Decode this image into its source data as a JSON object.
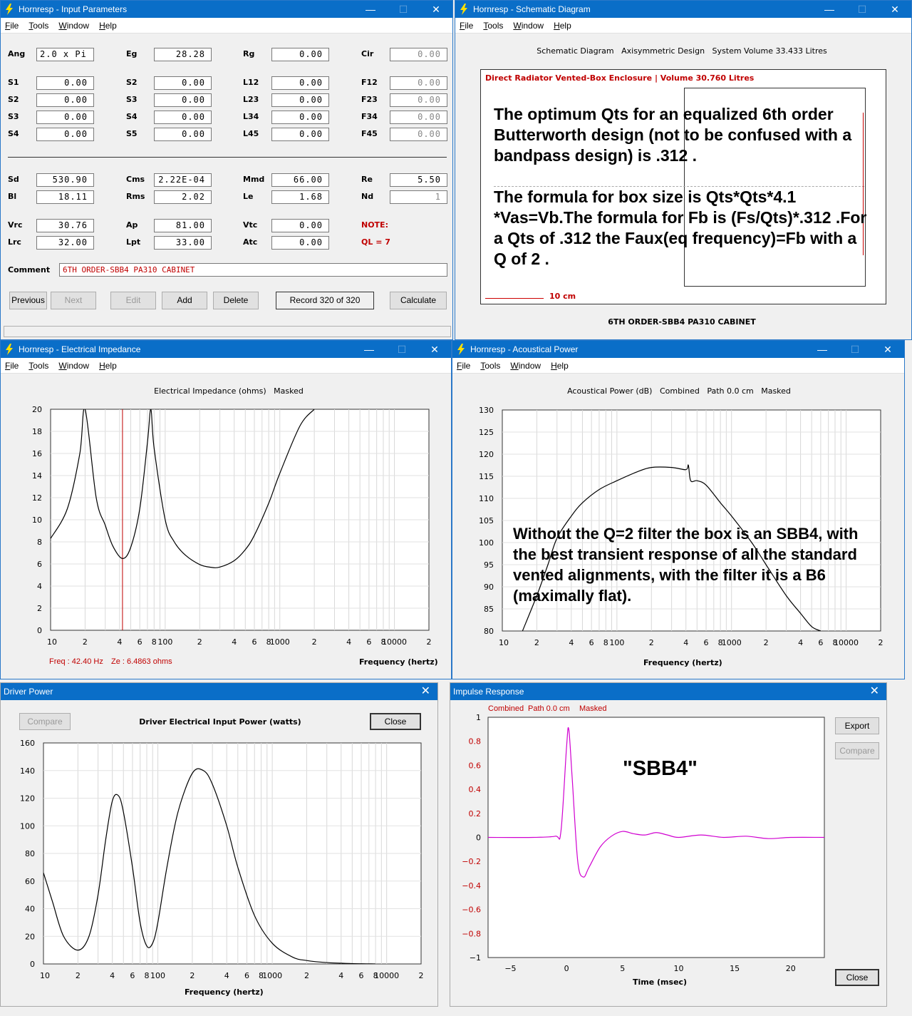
{
  "input_params": {
    "title": "Hornresp - Input Parameters",
    "menu": [
      "File",
      "Tools",
      "Window",
      "Help"
    ],
    "row1": [
      {
        "label": "Ang",
        "value": "2.0 x Pi"
      },
      {
        "label": "Eg",
        "value": "28.28"
      },
      {
        "label": "Rg",
        "value": "0.00"
      },
      {
        "label": "Cir",
        "value": "0.00"
      }
    ],
    "segments": [
      [
        {
          "label": "S1",
          "value": "0.00"
        },
        {
          "label": "S2",
          "value": "0.00"
        },
        {
          "label": "L12",
          "value": "0.00"
        },
        {
          "label": "F12",
          "value": "0.00"
        }
      ],
      [
        {
          "label": "S2",
          "value": "0.00"
        },
        {
          "label": "S3",
          "value": "0.00"
        },
        {
          "label": "L23",
          "value": "0.00"
        },
        {
          "label": "F23",
          "value": "0.00"
        }
      ],
      [
        {
          "label": "S3",
          "value": "0.00"
        },
        {
          "label": "S4",
          "value": "0.00"
        },
        {
          "label": "L34",
          "value": "0.00"
        },
        {
          "label": "F34",
          "value": "0.00"
        }
      ],
      [
        {
          "label": "S4",
          "value": "0.00"
        },
        {
          "label": "S5",
          "value": "0.00"
        },
        {
          "label": "L45",
          "value": "0.00"
        },
        {
          "label": "F45",
          "value": "0.00"
        }
      ]
    ],
    "driver": [
      [
        {
          "label": "Sd",
          "value": "530.90"
        },
        {
          "label": "Cms",
          "value": "2.22E-04"
        },
        {
          "label": "Mmd",
          "value": "66.00"
        },
        {
          "label": "Re",
          "value": "5.50"
        }
      ],
      [
        {
          "label": "Bl",
          "value": "18.11"
        },
        {
          "label": "Rms",
          "value": "2.02"
        },
        {
          "label": "Le",
          "value": "1.68"
        },
        {
          "label": "Nd",
          "value": "1"
        }
      ]
    ],
    "chamber": [
      [
        {
          "label": "Vrc",
          "value": "30.76"
        },
        {
          "label": "Ap",
          "value": "81.00"
        },
        {
          "label": "Vtc",
          "value": "0.00"
        },
        {
          "label": "NOTE:",
          "value": ""
        }
      ],
      [
        {
          "label": "Lrc",
          "value": "32.00"
        },
        {
          "label": "Lpt",
          "value": "33.00"
        },
        {
          "label": "Atc",
          "value": "0.00"
        },
        {
          "label": "QL = 7",
          "value": ""
        }
      ]
    ],
    "comment_label": "Comment",
    "comment": "6TH ORDER-SBB4 PA310 CABINET",
    "buttons": {
      "previous": "Previous",
      "next": "Next",
      "edit": "Edit",
      "add": "Add",
      "delete": "Delete",
      "record": "Record 320 of 320",
      "calculate": "Calculate"
    }
  },
  "schematic": {
    "title": "Hornresp - Schematic Diagram",
    "menu": [
      "File",
      "Tools",
      "Window",
      "Help"
    ],
    "header": "Schematic Diagram   Axisymmetric Design   System Volume 33.433 Litres",
    "box_caption": "Direct Radiator Vented-Box Enclosure | Volume 30.760 Litres",
    "note1": "The optimum Qts for an equalized 6th order Butterworth design (not to be confused with a bandpass design) is .312 .",
    "note2": "The formula for box size is Qts*Qts*4.1 *Vas=Vb.The formula for Fb is (Fs/Qts)*.312 .For a Qts of .312 the Faux(eq frequency)=Fb with a Q of 2 .",
    "scale": "10 cm",
    "footer": "6TH ORDER-SBB4 PA310 CABINET",
    "colors": {
      "caption": "#c00000"
    }
  },
  "impedance": {
    "title": "Hornresp - Electrical Impedance",
    "menu": [
      "File",
      "Tools",
      "Window",
      "Help"
    ],
    "chart_title": "Electrical Impedance (ohms)   Masked",
    "freq_readout": "Freq : 42.40 Hz",
    "ze_readout": "Ze : 6.4863 ohms",
    "xlabel": "Frequency (hertz)",
    "yticks": [
      "20",
      "18",
      "16",
      "14",
      "12",
      "10",
      "8",
      "6",
      "4",
      "2",
      "0"
    ],
    "xticks": [
      "10",
      "2",
      "4",
      "6",
      "8",
      "100",
      "2",
      "4",
      "6",
      "8",
      "1000",
      "2",
      "4",
      "6",
      "8",
      "10000",
      "2"
    ]
  },
  "acoustic": {
    "title": "Hornresp - Acoustical Power",
    "menu": [
      "File",
      "Tools",
      "Window",
      "Help"
    ],
    "chart_title": "Acoustical Power (dB)   Combined   Path 0.0 cm   Masked",
    "note": "Without the Q=2 filter the box is an SBB4, with the best transient response of all the standard vented alignments, with the filter it is a B6 (maximally flat).",
    "xlabel": "Frequency (hertz)",
    "yticks": [
      "130",
      "125",
      "120",
      "115",
      "110",
      "105",
      "100",
      "95",
      "90",
      "85",
      "80"
    ],
    "xticks": [
      "10",
      "2",
      "4",
      "6",
      "8",
      "100",
      "2",
      "4",
      "6",
      "8",
      "1000",
      "2",
      "4",
      "6",
      "8",
      "10000",
      "2"
    ]
  },
  "driver_power": {
    "title": "Driver Power",
    "compare": "Compare",
    "close": "Close",
    "chart_title": "Driver Electrical Input Power (watts)",
    "xlabel": "Frequency (hertz)",
    "yticks": [
      "160",
      "140",
      "120",
      "100",
      "80",
      "60",
      "40",
      "20",
      "0"
    ],
    "xticks": [
      "10",
      "2",
      "4",
      "6",
      "8",
      "100",
      "2",
      "4",
      "6",
      "8",
      "1000",
      "2",
      "4",
      "6",
      "8",
      "10000",
      "2"
    ]
  },
  "impulse": {
    "title": "Impulse Response",
    "legend": [
      "Combined",
      "Path 0.0 cm",
      "Masked"
    ],
    "note": "\"SBB4\"",
    "export": "Export",
    "compare": "Compare",
    "close": "Close",
    "xlabel": "Time (msec)",
    "yticks": [
      "1",
      "0.8",
      "0.6",
      "0.4",
      "0.2",
      "0",
      "−0.2",
      "−0.4",
      "−0.6",
      "−0.8",
      "−1"
    ],
    "xticks": [
      "−5",
      "0",
      "5",
      "10",
      "15",
      "20"
    ],
    "colors": {
      "trace": "#d000d0"
    }
  },
  "chart_data": [
    {
      "type": "line",
      "title": "Electrical Impedance (ohms)",
      "xlabel": "Frequency (hertz)",
      "ylabel": "",
      "xscale": "log",
      "xlim": [
        10,
        20000
      ],
      "ylim": [
        0,
        20
      ],
      "series": [
        {
          "x": [
            10,
            14,
            18,
            20,
            25,
            30,
            35,
            42.4,
            50,
            60,
            70,
            75,
            80,
            100,
            120,
            150,
            200,
            250,
            300,
            400,
            500,
            600,
            800,
            1000,
            1500,
            2000
          ],
          "y": [
            8.3,
            11,
            16,
            20,
            12,
            9.5,
            7.6,
            6.49,
            7.5,
            11,
            17,
            20,
            16.5,
            10,
            8,
            6.8,
            5.95,
            5.7,
            5.72,
            6.3,
            7.3,
            8.6,
            11.5,
            14.2,
            18.5,
            20
          ]
        }
      ],
      "marker_x": 42.4
    },
    {
      "type": "line",
      "title": "Acoustical Power (dB)",
      "xlabel": "Frequency (hertz)",
      "ylabel": "",
      "xscale": "log",
      "xlim": [
        10,
        20000
      ],
      "ylim": [
        80,
        130
      ],
      "series": [
        {
          "x": [
            15,
            20,
            25,
            30,
            40,
            50,
            70,
            100,
            150,
            200,
            300,
            400,
            420,
            440,
            500,
            600,
            800,
            1000,
            1500,
            2000,
            3000,
            4000,
            5000,
            6000
          ],
          "y": [
            80,
            88,
            95,
            101,
            106,
            109,
            112,
            114,
            116,
            117,
            117,
            116.5,
            117.5,
            114,
            114,
            113,
            109,
            106,
            100,
            95,
            88,
            84,
            81,
            80
          ]
        }
      ]
    },
    {
      "type": "line",
      "title": "Driver Electrical Input Power (watts)",
      "xlabel": "Frequency (hertz)",
      "ylabel": "",
      "xscale": "log",
      "xlim": [
        10,
        20000
      ],
      "ylim": [
        0,
        160
      ],
      "series": [
        {
          "x": [
            10,
            12,
            15,
            20,
            25,
            30,
            35,
            40,
            45,
            50,
            60,
            70,
            80,
            90,
            100,
            120,
            150,
            200,
            250,
            300,
            400,
            500,
            700,
            1000,
            1500,
            2000,
            3000,
            5000,
            8000
          ],
          "y": [
            66,
            45,
            20,
            10,
            20,
            50,
            90,
            118,
            122,
            110,
            70,
            30,
            13,
            15,
            30,
            70,
            110,
            138,
            140,
            130,
            100,
            70,
            35,
            15,
            5,
            2.5,
            1,
            0.3,
            0
          ]
        }
      ]
    },
    {
      "type": "line",
      "title": "Impulse Response",
      "xlabel": "Time (msec)",
      "ylabel": "",
      "xlim": [
        -7,
        23
      ],
      "ylim": [
        -1,
        1
      ],
      "series": [
        {
          "name": "Combined",
          "x": [
            -7,
            -3,
            -1,
            -0.5,
            0,
            0.2,
            0.5,
            1,
            1.5,
            2,
            3,
            4,
            5,
            6,
            7,
            8,
            9,
            10,
            12,
            14,
            16,
            18,
            20,
            23
          ],
          "y": [
            0,
            0,
            0.01,
            0.05,
            0.75,
            0.9,
            0.5,
            -0.2,
            -0.33,
            -0.25,
            -0.08,
            0.01,
            0.05,
            0.03,
            0.02,
            0.04,
            0.02,
            0.0,
            0.02,
            0.0,
            0.01,
            -0.01,
            0.0,
            0.0
          ]
        }
      ]
    }
  ]
}
